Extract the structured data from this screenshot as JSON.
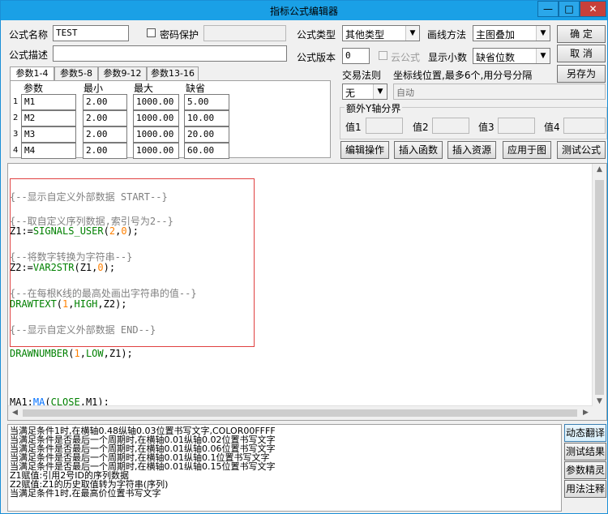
{
  "window": {
    "title": "指标公式编辑器",
    "minimize": "—",
    "maximize": "□",
    "close": "✕"
  },
  "form": {
    "name_label": "公式名称",
    "name_value": "TEST",
    "password_label": "密码保护",
    "password_value": "",
    "desc_label": "公式描述",
    "desc_value": "",
    "type_label": "公式类型",
    "type_value": "其他类型",
    "draw_label": "画线方法",
    "draw_value": "主图叠加",
    "version_label": "公式版本",
    "version_value": "0",
    "cloud_label": "云公式",
    "decimal_label": "显示小数",
    "decimal_value": "缺省位数",
    "trade_label": "交易法则",
    "trade_value": "无",
    "coord_label": "坐标线位置,最多6个,用分号分隔",
    "coord_value": "自动",
    "extra_axis_label": "额外Y轴分界",
    "val1_label": "值1",
    "val2_label": "值2",
    "val3_label": "值3",
    "val4_label": "值4"
  },
  "buttons": {
    "ok": "确  定",
    "cancel": "取  消",
    "save_as": "另存为",
    "edit_op": "编辑操作",
    "insert_func": "插入函数",
    "insert_res": "插入资源",
    "apply_chart": "应用于图",
    "test_formula": "测试公式"
  },
  "tabs": [
    "参数1-4",
    "参数5-8",
    "参数9-12",
    "参数13-16"
  ],
  "params": {
    "headers": {
      "name": "参数",
      "min": "最小",
      "max": "最大",
      "default": "缺省"
    },
    "rows": [
      {
        "n": "1",
        "name": "M1",
        "min": "2.00",
        "max": "1000.00",
        "def": "5.00"
      },
      {
        "n": "2",
        "name": "M2",
        "min": "2.00",
        "max": "1000.00",
        "def": "10.00"
      },
      {
        "n": "3",
        "name": "M3",
        "min": "2.00",
        "max": "1000.00",
        "def": "20.00"
      },
      {
        "n": "4",
        "name": "M4",
        "min": "2.00",
        "max": "1000.00",
        "def": "60.00"
      }
    ]
  },
  "code": {
    "c1": "{--显示自定义外部数据 START--}",
    "c2": "{--取自定义序列数据,索引号为2--}",
    "l3": [
      "Z1:=",
      "SIGNALS_USER",
      "(",
      "2",
      ",",
      "0",
      ");"
    ],
    "c4": "{--将数字转换为字符串--}",
    "l5": [
      "Z2:=",
      "VAR2STR",
      "(Z1,",
      "0",
      ");"
    ],
    "c6": "{--在每根K线的最高处画出字符串的值--}",
    "l7": [
      "DRAWTEXT",
      "(",
      "1",
      ",",
      "HIGH",
      ",Z2);"
    ],
    "c8": "{--显示自定义外部数据 END--}",
    "l9": [
      "DRAWNUMBER",
      "(",
      "1",
      ",",
      "LOW",
      ",Z1);"
    ],
    "l10": [
      "MA1:",
      "MA",
      "(",
      "CLOSE",
      ",M1);"
    ]
  },
  "console": [
    "当满足条件1时,在横轴0.48纵轴0.03位置书写文字,COLOR00FFFF",
    "当满足条件是否最后一个周期时,在横轴0.01纵轴0.02位置书写文字",
    "当满足条件是否最后一个周期时,在横轴0.01纵轴0.06位置书写文字",
    "当满足条件是否最后一个周期时,在横轴0.01纵轴0.1位置书写文字",
    "当满足条件是否最后一个周期时,在横轴0.01纵轴0.15位置书写文字",
    "Z1赋值:引用2号ID的序列数据",
    "Z2赋值:Z1的历史取值转为字符串(序列)",
    "当满足条件1时,在最高价位置书写文字"
  ],
  "side_buttons": [
    "动态翻译",
    "测试结果",
    "参数精灵",
    "用法注释"
  ],
  "colors": {
    "titlebar": "#1aa0e6",
    "comment": "#808080",
    "keyword": "#008000",
    "number": "#ff8000",
    "function": "#0070ff",
    "highlight_box": "#e04040"
  }
}
